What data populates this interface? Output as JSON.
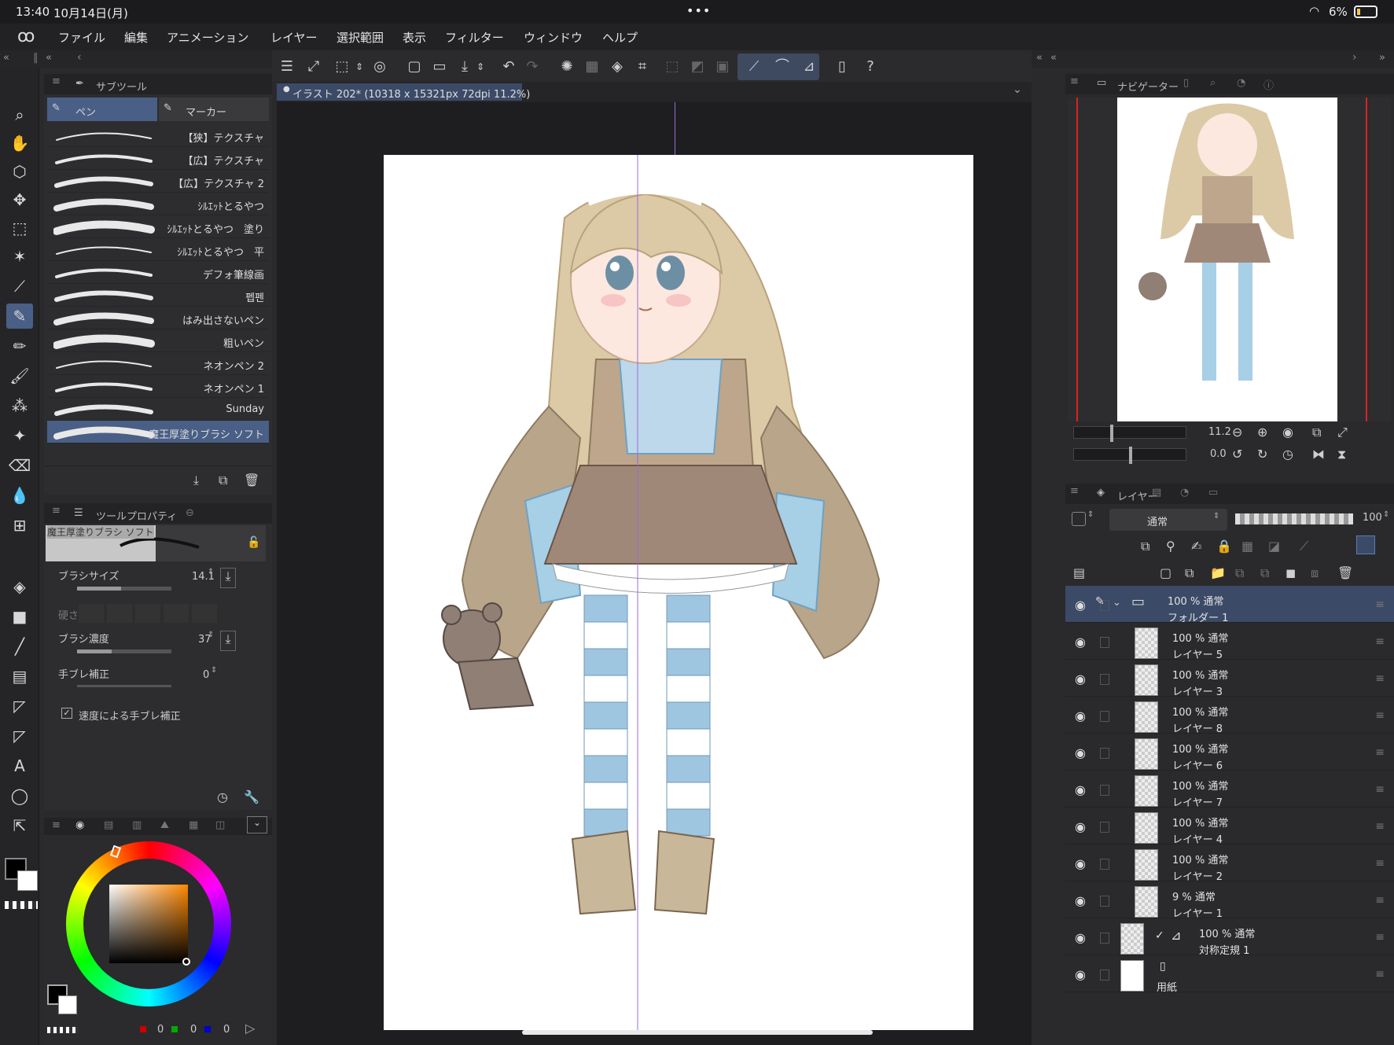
{
  "status": {
    "time": "13:40",
    "date": "10月14日(月)",
    "dots": "•••",
    "wifi_icon": "wifi-icon",
    "battery": "6%"
  },
  "menu": {
    "logo_icon": "clip-logo-icon",
    "items": [
      "ファイル",
      "編集",
      "アニメーション",
      "レイヤー",
      "選択範囲",
      "表示",
      "フィルター",
      "ウィンドウ",
      "ヘルプ"
    ]
  },
  "document": {
    "tab_title": "イラスト 202* (10318 x 15321px 72dpi 11.2%)"
  },
  "subtool": {
    "panel_title": "サブツール",
    "tabs": [
      "ペン",
      "マーカー"
    ],
    "brushes": [
      "【狭】テクスチャ",
      "【広】テクスチャ",
      "【広】テクスチャ 2",
      "ｼﾙｴｯﾄとるやつ",
      "ｼﾙｴｯﾄとるやつ　塗り",
      "ｼﾙｴｯﾄとるやつ　平",
      "デフォ筆線画",
      "펩펜",
      "はみ出さないペン",
      "粗いペン",
      "ネオンペン 2",
      "ネオンペン 1",
      "Sunday",
      "魔王厚塗りブラシ ソフト"
    ],
    "selected_index": 13
  },
  "toolprop": {
    "panel_title": "ツールプロパティ",
    "preset_name": "魔王厚塗りブラシ ソフト",
    "brush_size_label": "ブラシサイズ",
    "brush_size_value": "14.1",
    "hardness_label": "硬さ",
    "density_label": "ブラシ濃度",
    "density_value": "37",
    "stabilization_label": "手ブレ補正",
    "stabilization_value": "0",
    "speed_stab_label": "速度による手ブレ補正",
    "speed_stab_checked": true
  },
  "color": {
    "main": "#000000",
    "sub": "#ffffff",
    "r": "0",
    "g": "0",
    "b": "0"
  },
  "navigator": {
    "panel_title": "ナビゲーター",
    "zoom": "11.2",
    "rotation": "0.0"
  },
  "layers": {
    "panel_title": "レイヤー",
    "blend_mode": "通常",
    "opacity": "100",
    "items": [
      {
        "mode": "100 % 通常",
        "name": "フォルダー 1",
        "folder": true
      },
      {
        "mode": "100 % 通常",
        "name": "レイヤー 5"
      },
      {
        "mode": "100 % 通常",
        "name": "レイヤー 3"
      },
      {
        "mode": "100 % 通常",
        "name": "レイヤー 8"
      },
      {
        "mode": "100 % 通常",
        "name": "レイヤー 6"
      },
      {
        "mode": "100 % 通常",
        "name": "レイヤー 7"
      },
      {
        "mode": "100 % 通常",
        "name": "レイヤー 4"
      },
      {
        "mode": "100 % 通常",
        "name": "レイヤー 2"
      },
      {
        "mode": "9 % 通常",
        "name": "レイヤー 1"
      },
      {
        "mode": "100 % 通常",
        "name": "対称定規 1",
        "ruler": true
      },
      {
        "mode": "",
        "name": "用紙",
        "paper": true
      }
    ]
  }
}
